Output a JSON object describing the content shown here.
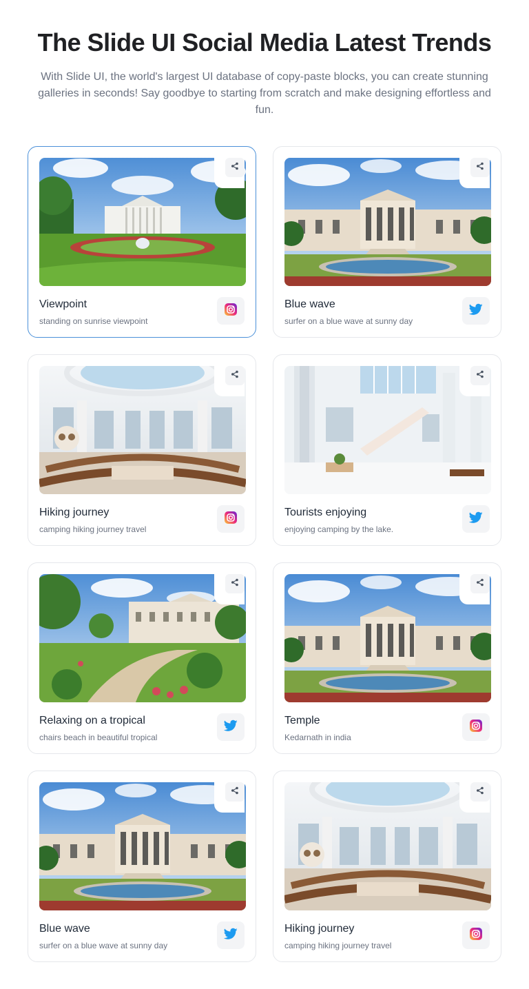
{
  "header": {
    "title": "The Slide UI Social Media Latest Trends",
    "subtitle": "With Slide UI, the world's largest UI database of copy-paste blocks, you can create stunning galleries in seconds! Say goodbye to starting from scratch and make designing effortless and fun."
  },
  "colors": {
    "accent_border": "#4a90d9",
    "twitter": "#1d9bf0",
    "instagram_gradient": [
      "#f9ce34",
      "#ee2a7b",
      "#6228d7"
    ]
  },
  "cards": [
    {
      "title": "Viewpoint",
      "desc": "standing on sunrise viewpoint",
      "social": "instagram-icon",
      "scene": "garden-mansion",
      "active": true
    },
    {
      "title": "Blue wave",
      "desc": "surfer on a blue wave at sunny day",
      "social": "twitter-icon",
      "scene": "columned-building",
      "active": false
    },
    {
      "title": "Hiking journey",
      "desc": "camping hiking journey travel",
      "social": "instagram-icon",
      "scene": "council-chamber",
      "active": false
    },
    {
      "title": "Tourists enjoying",
      "desc": "enjoying camping by the lake.",
      "social": "twitter-icon",
      "scene": "atrium",
      "active": false
    },
    {
      "title": "Relaxing on a tropical",
      "desc": "chairs beach in beautiful tropical",
      "social": "twitter-icon",
      "scene": "garden-palace",
      "active": false
    },
    {
      "title": "Temple",
      "desc": "Kedarnath in india",
      "social": "instagram-icon",
      "scene": "columned-building",
      "active": false
    },
    {
      "title": "Blue wave",
      "desc": "surfer on a blue wave at sunny day",
      "social": "twitter-icon",
      "scene": "columned-building",
      "active": false
    },
    {
      "title": "Hiking journey",
      "desc": "camping hiking journey travel",
      "social": "instagram-icon",
      "scene": "council-chamber",
      "active": false
    }
  ]
}
